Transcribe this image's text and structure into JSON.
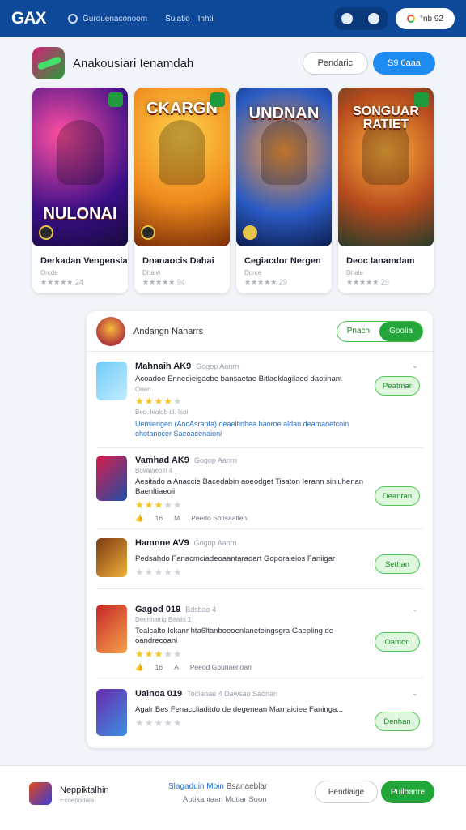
{
  "header": {
    "logo": "GAX",
    "search_placeholder": "Gurouenaconoom",
    "nav": [
      "Suiatio",
      "Inhti"
    ],
    "account_label": "°nb 92"
  },
  "featured": {
    "title": "Anakousiari Ienamdah",
    "btn_outline": "Pendaric",
    "btn_primary": "S9 0aaa",
    "cards": [
      {
        "art_text": "NULONAI",
        "title": "Derkadan Vengensia",
        "sub": "Orcde",
        "rating": "★★★★★ 24"
      },
      {
        "art_text": "CKARGN",
        "title": "Dnanaocis Dahai",
        "sub": "Dhaiw",
        "rating": "★★★★★ 94"
      },
      {
        "art_text": "UNDNAN",
        "title": "Cegiacdor Nergen",
        "sub": "Dorce",
        "rating": "★★★★★ 29"
      },
      {
        "art_text": "SONGUAR RATIET",
        "title": "Deoc Ianamdam",
        "sub": "Dnale",
        "rating": "★★★★★ 29"
      }
    ]
  },
  "list": {
    "title": "Andangn Nanarrs",
    "toggle_off": "Pnach",
    "toggle_on": "Goolia",
    "items": [
      {
        "name": "Mahnaih AK9",
        "meta": "Gogop Aanrn",
        "desc": "Acoadoe Ennedieigacbe bansaetae Bitlaoklagilaed daotinant",
        "extra": "Onen",
        "small": "Beo. leolob di. Isoi",
        "link": "Uemierigen (AocAsranta) deaeitinbea baoroe aldan deamaoetcoin ohotanocer Saeoaconaioni",
        "button": "Peatmar"
      },
      {
        "name": "Vamhad AK9",
        "meta": "Gogop Aanrn",
        "desc": "Aesitado a Anaccie Bacedabin aoeodget Tisaton Ierann siniuhenan Baenltiaeoii",
        "small": "Bovalaeoln 4",
        "foot": [
          "16",
          "M"
        ],
        "foot_label": "Peedo Sbtisaatlen",
        "button": "Deanran"
      },
      {
        "name": "Hamnne AV9",
        "meta": "Gogop Aanrn",
        "desc": "Pedsahdo Fanacmciadeoaantaradart Goporaieios Faniigar",
        "button": "Sethan"
      },
      {
        "name": "Gagod 019",
        "meta": "Bdsbao 4",
        "desc": "Tealcalto Ickanr hta6ltanboeoenlaneteingsgra Gaepling de oandrecoani",
        "small": "Deenhairig Beaiis 1",
        "foot": [
          "16",
          "A"
        ],
        "foot_label": "Peeod Gbunaenoan",
        "button": "Oamon"
      },
      {
        "name": "Uainoa 019",
        "meta": "Toclanae 4 Dawsao Saonan",
        "desc": "Agalr Bes Fenaccliaditdo de degenean Marnaiciee Faninga...",
        "button": "Denhan"
      }
    ]
  },
  "bottom": {
    "name": "Neppiktalhin",
    "sub": "Ecoepodaie",
    "mid1": "Slagaduin Moin",
    "mid1b": "Bsanaeblar",
    "mid2": "Aptikaniaan Motiar Soon",
    "btn1": "Pendiaige",
    "btn2": "Puilbanre"
  },
  "colors": {
    "header_bg": "#0e4a99",
    "primary_blue": "#1d8bf0",
    "green": "#22a63a",
    "star": "#f5c518"
  }
}
